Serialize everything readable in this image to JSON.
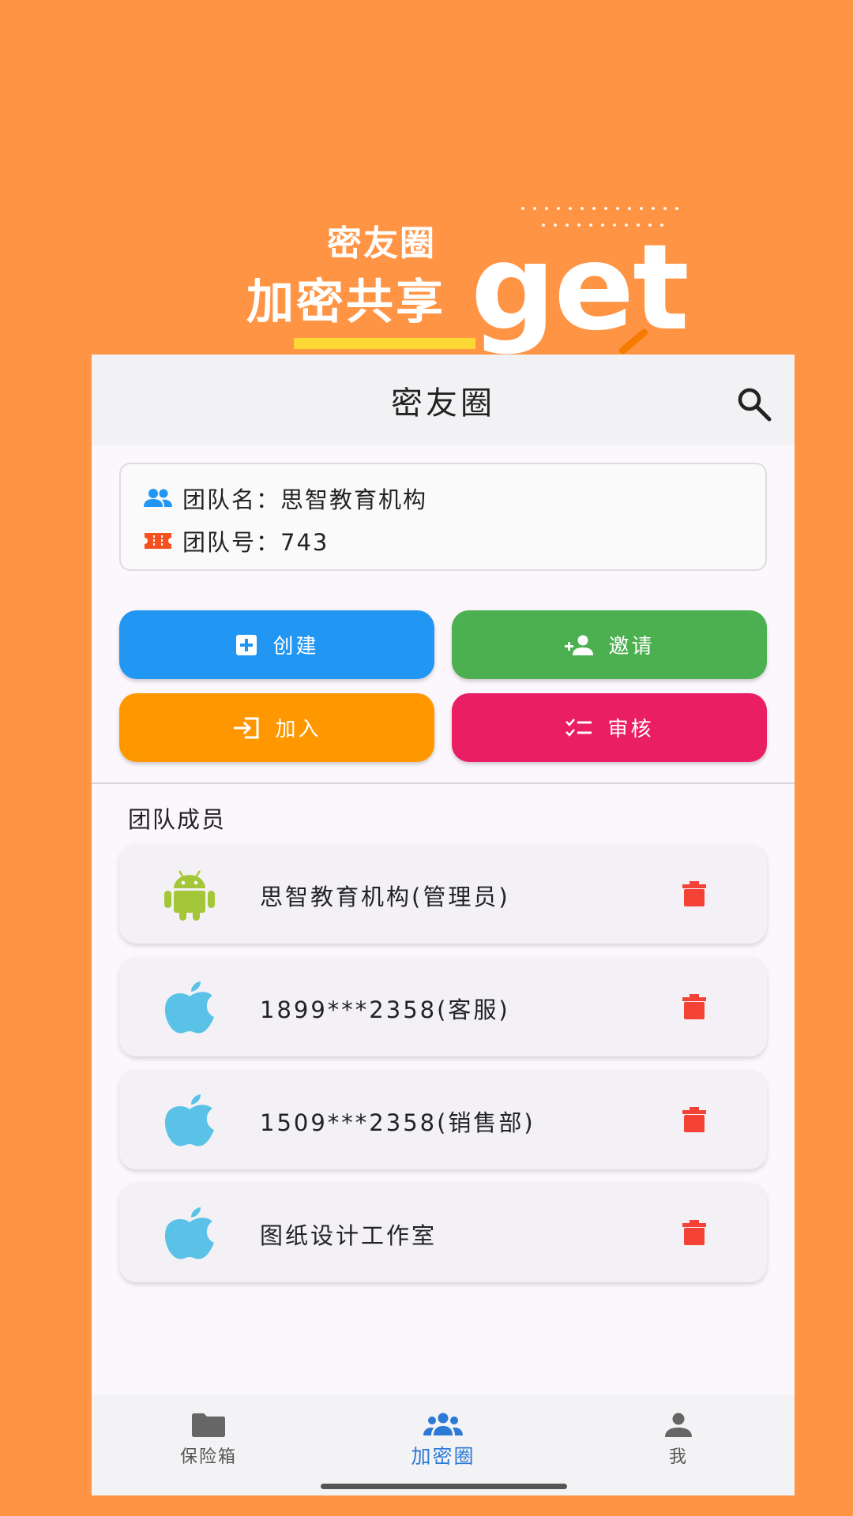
{
  "promo": {
    "small_title": "密友圈",
    "big_title": "加密共享",
    "get_text": "get"
  },
  "appbar": {
    "title": "密友圈"
  },
  "team": {
    "name_line": "团队名：思智教育机构",
    "number_line": "团队号：743"
  },
  "actions": {
    "create": "创建",
    "invite": "邀请",
    "join": "加入",
    "review": "审核"
  },
  "members_section": {
    "title": "团队成员",
    "items": [
      {
        "name": "思智教育机构(管理员)",
        "platform_icon": "android-icon"
      },
      {
        "name": "1899***2358(客服)",
        "platform_icon": "apple-icon"
      },
      {
        "name": "1509***2358(销售部)",
        "platform_icon": "apple-icon"
      },
      {
        "name": "图纸设计工作室",
        "platform_icon": "apple-icon"
      }
    ]
  },
  "nav": {
    "vault": "保险箱",
    "circle": "加密圈",
    "me": "我",
    "active": "circle"
  },
  "colors": {
    "background": "#ff9444",
    "create": "#2196f3",
    "invite": "#4caf50",
    "join": "#ff9800",
    "review": "#e91e63",
    "delete": "#f44336",
    "nav_active": "#2a7ad6"
  }
}
